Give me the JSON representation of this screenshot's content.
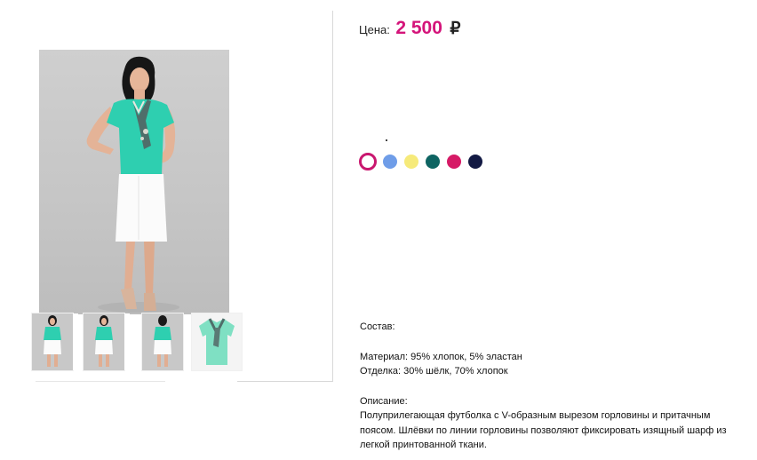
{
  "price": {
    "label": "Цена:",
    "value": "2 500",
    "currency": "₽"
  },
  "colors": {
    "swatches": [
      {
        "name": "white",
        "color": "#ffffff",
        "selected": true
      },
      {
        "name": "light-blue",
        "color": "#6f9de8",
        "selected": false
      },
      {
        "name": "yellow",
        "color": "#f6ea7a",
        "selected": false
      },
      {
        "name": "dark-teal",
        "color": "#0e6462",
        "selected": false
      },
      {
        "name": "raspberry",
        "color": "#d61a66",
        "selected": false
      },
      {
        "name": "navy",
        "color": "#131a44",
        "selected": false
      }
    ]
  },
  "details": {
    "composition_label": "Состав:",
    "material": "Материал: 95% хлопок, 5% эластан",
    "trim": "Отделка: 30% шёлк, 70% хлопок",
    "description_label": "Описание:",
    "description": "Полуприлегающая футболка с V-образным вырезом горловины и притачным поясом. Шлёвки по линии горловины позволяют фиксировать изящный шарф из легкой принтованной ткани."
  },
  "gallery": {
    "thumbnails": [
      {
        "icon": "model-photo-thumbnail"
      },
      {
        "icon": "model-photo-thumbnail"
      },
      {
        "icon": "model-photo-thumbnail"
      },
      {
        "icon": "tshirt-photo-thumbnail"
      }
    ]
  },
  "accent_color": "#d4147a"
}
